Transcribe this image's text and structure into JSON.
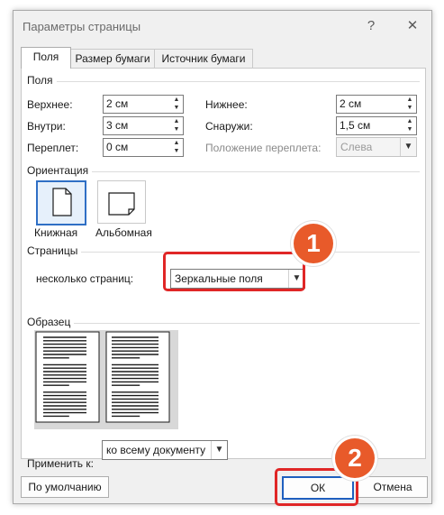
{
  "window": {
    "title": "Параметры страницы",
    "help_symbol": "?",
    "close_symbol": "✕"
  },
  "tabs": [
    {
      "label": "Поля",
      "active": true
    },
    {
      "label": "Размер бумаги",
      "active": false
    },
    {
      "label": "Источник бумаги",
      "active": false
    }
  ],
  "margins": {
    "group_title": "Поля",
    "top_label": "Верхнее:",
    "top_value": "2 см",
    "bottom_label": "Нижнее:",
    "bottom_value": "2 см",
    "inside_label": "Внутри:",
    "inside_value": "3 см",
    "outside_label": "Снаружи:",
    "outside_value": "1,5 см",
    "gutter_label": "Переплет:",
    "gutter_value": "0 см",
    "gutter_pos_label": "Положение переплета:",
    "gutter_pos_value": "Слева"
  },
  "orientation": {
    "group_title": "Ориентация",
    "portrait_label": "Книжная",
    "landscape_label": "Альбомная",
    "selected": "portrait"
  },
  "pages": {
    "group_title": "Страницы",
    "multiple_label": "несколько страниц:",
    "multiple_value": "Зеркальные поля"
  },
  "preview": {
    "group_title": "Образец"
  },
  "apply": {
    "label": "Применить к:",
    "value": "ко всему документу"
  },
  "buttons": {
    "default": "По умолчанию",
    "ok": "ОК",
    "cancel": "Отмена"
  },
  "annotations": {
    "badge1": "1",
    "badge2": "2",
    "color": "#e85a2a",
    "highlight_color": "#e02626"
  }
}
